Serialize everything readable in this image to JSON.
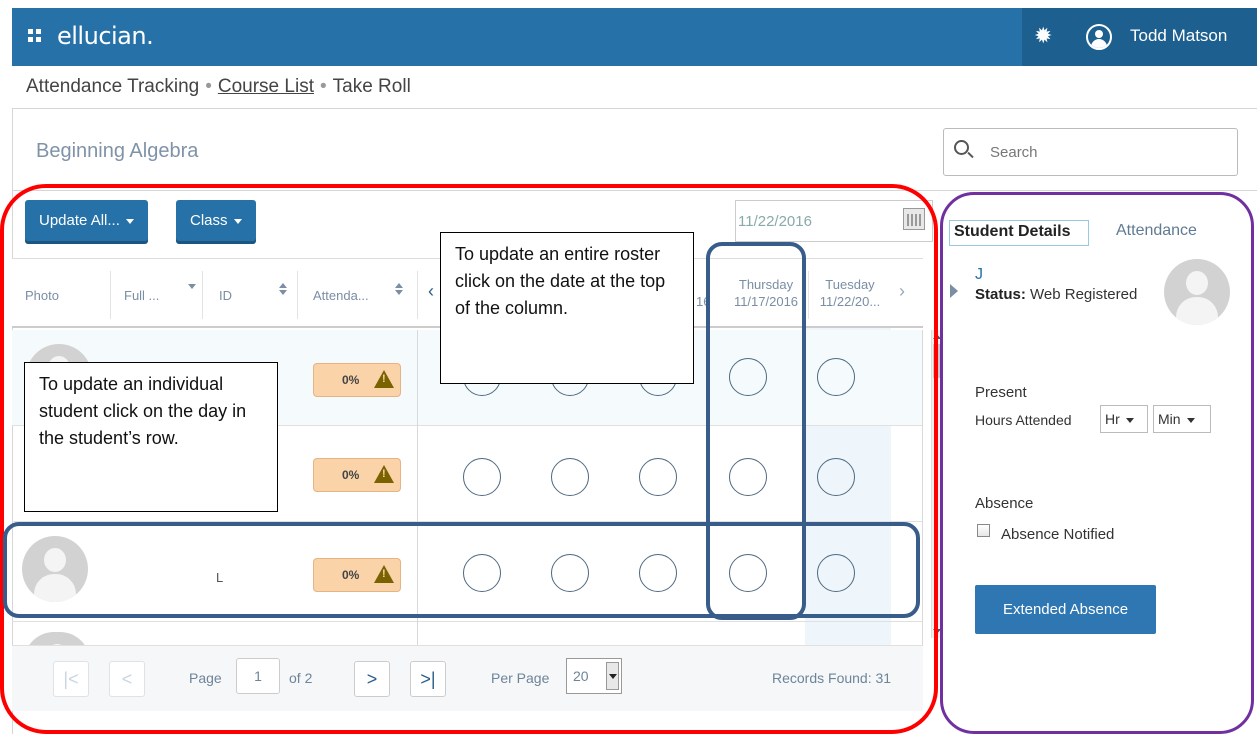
{
  "app": {
    "brand": "ellucian.",
    "username": "Todd Matson"
  },
  "breadcrumb": {
    "item1": "Attendance Tracking",
    "item2": "Course List",
    "item3": "Take Roll",
    "separator": "•"
  },
  "course": {
    "title": "Beginning Algebra"
  },
  "search": {
    "placeholder": "Search"
  },
  "toolbar": {
    "update_all": "Update All...",
    "class": "Class",
    "date": "11/22/2016"
  },
  "table": {
    "headers": {
      "photo": "Photo",
      "full_name": "Full ...",
      "id": "ID",
      "attendance": "Attenda...",
      "partial_date": "16",
      "day4": "Thursday",
      "date4": "11/17/2016",
      "day5": "Tuesday",
      "date5": "11/22/20..."
    },
    "rows": [
      {
        "id": "",
        "attendance": "0%"
      },
      {
        "id": "",
        "attendance": "0%"
      },
      {
        "id": "L",
        "attendance": "0%"
      }
    ]
  },
  "pager": {
    "page_label": "Page",
    "page_value": "1",
    "of_label": "of 2",
    "per_page_label": "Per Page",
    "per_page_value": "20",
    "records": "Records Found: 31"
  },
  "panel": {
    "tab_details": "Student Details",
    "tab_attendance": "Attendance",
    "student_initial": "J",
    "status_label": "Status:",
    "status_value": "Web Registered",
    "present_label": "Present",
    "hours_label": "Hours Attended",
    "hr_option": "Hr",
    "min_option": "Min",
    "absence_label": "Absence",
    "absence_notified": "Absence Notified",
    "extended_absence": "Extended Absence"
  },
  "annotations": {
    "roster": "To update an entire roster click on the date at the top of the column.",
    "individual": "To update an individual student click on the day in the student’s row."
  },
  "colors": {
    "brand_blue": "#2672a8",
    "annotation_red": "#ff0000",
    "annotation_purple": "#7030a0",
    "annotation_blue": "#385d8a",
    "warning_bg": "#fbd3a9"
  }
}
